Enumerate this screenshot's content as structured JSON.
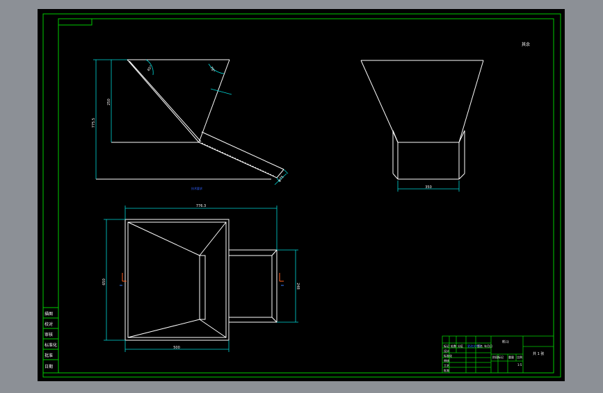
{
  "window": {
    "background_color": "#8c9096",
    "canvas_color": "#000000"
  },
  "colors": {
    "frame": "#00cc00",
    "outline": "#ffffff",
    "dimension": "#00d8d8",
    "annotation_blue": "#3060ff",
    "axis_x": "#ff6020",
    "axis_y": "#3a7bff",
    "text": "#ffffff"
  },
  "side_view": {
    "dim_height": "250",
    "dim_total": "775.5",
    "dim_angle_left": "45°",
    "dim_angle_right": "76°",
    "dim_outlet": "φ75",
    "caption": "技术要求"
  },
  "front_view": {
    "dim_bottom": "350"
  },
  "top_view": {
    "dim_top": "776.3",
    "dim_left": "650",
    "dim_bottom": "500",
    "dim_right": "248"
  },
  "corner_note": "其余",
  "left_stamp": {
    "rows": [
      "描图",
      "校对",
      "审核",
      "标准化",
      "批准",
      "日期"
    ]
  },
  "title_block": {
    "drawing_name": "料斗",
    "scale": "1:5",
    "sheet_label": "共 1 张",
    "row_labels": [
      "标记",
      "处数",
      "分区",
      "更改文件号",
      "签名",
      "年月日"
    ],
    "row_labels_2": [
      "设计",
      "标准化",
      "审核",
      "工艺",
      "批准"
    ],
    "weight_label": "重量",
    "scale_label": "比例",
    "stage_label": "阶段标记"
  }
}
